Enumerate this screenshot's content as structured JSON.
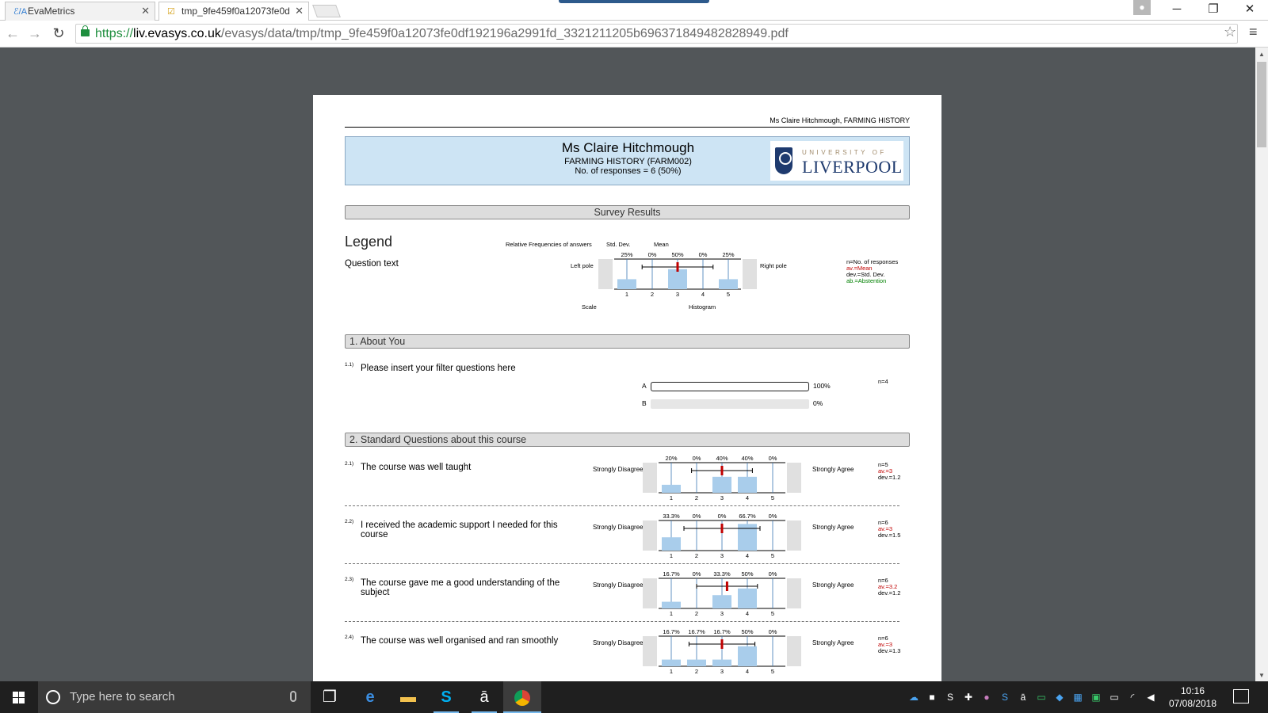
{
  "browser": {
    "tabs": [
      {
        "label": "EvaMetrics",
        "icon": "evametrics-icon",
        "active": false
      },
      {
        "label": "tmp_9fe459f0a12073fe0d",
        "icon": "checkbox-icon",
        "active": true
      }
    ],
    "url": {
      "scheme": "https://",
      "host": "liv.evasys.co.uk",
      "path": "/evasys/data/tmp/tmp_9fe459f0a12073fe0df192196a2991fd_3321211205b696371849482828949.pdf"
    }
  },
  "report": {
    "page_header": "Ms Claire Hitchmough, FARMING HISTORY",
    "lecturer": "Ms Claire Hitchmough",
    "course": "FARMING HISTORY (FARM002)",
    "responses": "No. of responses = 6 (50%)",
    "logo": {
      "top": "UNIVERSITY OF",
      "main": "LIVERPOOL"
    },
    "survey_results": "Survey Results",
    "legend": {
      "title": "Legend",
      "question_text": "Question text",
      "rel_freq": "Relative Frequencies of answers",
      "std_dev": "Std. Dev.",
      "mean": "Mean",
      "left_pole": "Left pole",
      "right_pole": "Right pole",
      "scale": "Scale",
      "histogram": "Histogram",
      "pcts": [
        "25%",
        "0%",
        "50%",
        "0%",
        "25%"
      ],
      "values": [
        25,
        0,
        50,
        0,
        25
      ],
      "mean_value": 3,
      "dev_value": 1.4,
      "key_n": "n=No. of responses",
      "key_av": "av.=Mean",
      "key_dev": "dev.=Std. Dev.",
      "key_ab": "ab.=Abstention"
    },
    "section1": {
      "title": "1. About You",
      "q_num": "1.1)",
      "q_text": "Please insert your filter questions here",
      "options": [
        {
          "label": "A",
          "pct": "100%",
          "value": 1.0
        },
        {
          "label": "B",
          "pct": "0%",
          "value": 0
        }
      ],
      "n": "n=4"
    },
    "section2": {
      "title": "2. Standard Questions about this course",
      "left_pole": "Strongly Disagree",
      "right_pole": "Strongly Agree",
      "scale": [
        "1",
        "2",
        "3",
        "4",
        "5"
      ],
      "questions": [
        {
          "num": "2.1)",
          "text": "The course was well taught",
          "pcts": [
            "20%",
            "0%",
            "40%",
            "40%",
            "0%"
          ],
          "values": [
            20,
            0,
            40,
            40,
            0
          ],
          "mean": 3,
          "dev": 1.2,
          "n": "n=5",
          "av": "av.=3",
          "dev_label": "dev.=1.2"
        },
        {
          "num": "2.2)",
          "text": "I received the academic support I needed for this course",
          "pcts": [
            "33.3%",
            "0%",
            "0%",
            "66.7%",
            "0%"
          ],
          "values": [
            33.3,
            0,
            0,
            66.7,
            0
          ],
          "mean": 3,
          "dev": 1.5,
          "n": "n=6",
          "av": "av.=3",
          "dev_label": "dev.=1.5"
        },
        {
          "num": "2.3)",
          "text": "The course gave me a good understanding of the subject",
          "pcts": [
            "16.7%",
            "0%",
            "33.3%",
            "50%",
            "0%"
          ],
          "values": [
            16.7,
            0,
            33.3,
            50,
            0
          ],
          "mean": 3.2,
          "dev": 1.2,
          "n": "n=6",
          "av": "av.=3.2",
          "dev_label": "dev.=1.2"
        },
        {
          "num": "2.4)",
          "text": "The course was well organised and ran smoothly",
          "pcts": [
            "16.7%",
            "16.7%",
            "16.7%",
            "50%",
            "0%"
          ],
          "values": [
            16.7,
            16.7,
            16.7,
            50,
            0
          ],
          "mean": 3,
          "dev": 1.3,
          "n": "n=6",
          "av": "av.=3",
          "dev_label": "dev.=1.3"
        }
      ]
    }
  },
  "taskbar": {
    "search_placeholder": "Type here to search",
    "time": "10:16",
    "date": "07/08/2018"
  },
  "colors": {
    "bar": "#a9cdeb",
    "mean_marker": "#c00000",
    "header_bg": "#cde4f4",
    "abstention": "#008000"
  }
}
